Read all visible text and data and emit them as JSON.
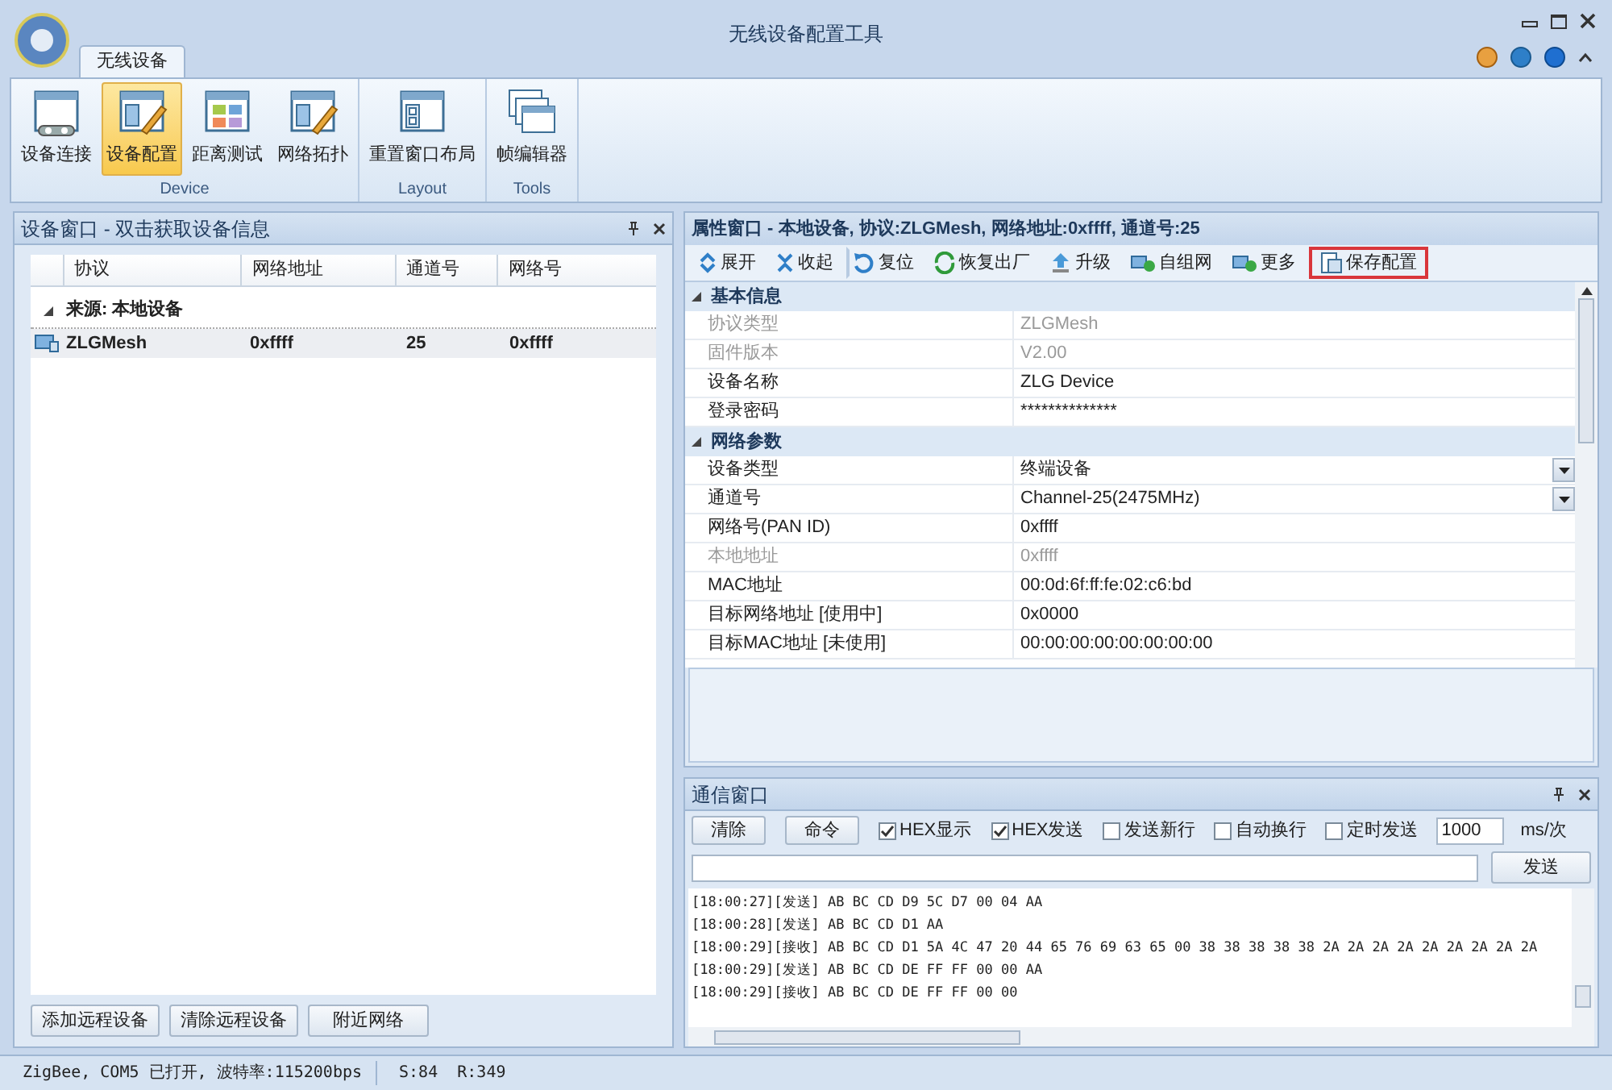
{
  "window": {
    "title": "无线设备配置工具"
  },
  "ribbon": {
    "tab": "无线设备",
    "groups": [
      {
        "label": "Device",
        "items": [
          {
            "label": "设备连接",
            "selected": false
          },
          {
            "label": "设备配置",
            "selected": true
          },
          {
            "label": "距离测试",
            "selected": false
          },
          {
            "label": "网络拓扑",
            "selected": false
          }
        ]
      },
      {
        "label": "Layout",
        "items": [
          {
            "label": "重置窗口布局",
            "selected": false
          }
        ]
      },
      {
        "label": "Tools",
        "items": [
          {
            "label": "帧编辑器",
            "selected": false
          }
        ]
      }
    ]
  },
  "device_panel": {
    "title": "设备窗口 - 双击获取设备信息",
    "columns": [
      "协议",
      "网络地址",
      "通道号",
      "网络号"
    ],
    "group": {
      "label": "来源: 本地设备",
      "expanded": true,
      "rows": [
        {
          "cells": [
            "ZLGMesh",
            "0xffff",
            "25",
            "0xffff"
          ],
          "selected": true
        }
      ]
    },
    "buttons": [
      "添加远程设备",
      "清除远程设备",
      "附近网络"
    ]
  },
  "property_panel": {
    "title": "属性窗口 - 本地设备, 协议:ZLGMesh, 网络地址:0xffff, 通道号:25",
    "toolbar": [
      {
        "label": "展开",
        "highlighted": false
      },
      {
        "label": "收起",
        "highlighted": false
      },
      {
        "label": "复位",
        "highlighted": false
      },
      {
        "label": "恢复出厂",
        "highlighted": false
      },
      {
        "label": "升级",
        "highlighted": false
      },
      {
        "label": "自组网",
        "highlighted": false
      },
      {
        "label": "更多",
        "highlighted": false
      },
      {
        "label": "保存配置",
        "highlighted": true
      }
    ],
    "categories": [
      {
        "label": "基本信息",
        "expanded": true,
        "rows": [
          {
            "name": "协议类型",
            "value": "ZLGMesh",
            "disabled": true,
            "kind": "text"
          },
          {
            "name": "固件版本",
            "value": "V2.00",
            "disabled": true,
            "kind": "text"
          },
          {
            "name": "设备名称",
            "value": "ZLG Device",
            "disabled": false,
            "kind": "text"
          },
          {
            "name": "登录密码",
            "value": "**************",
            "disabled": false,
            "kind": "text"
          }
        ]
      },
      {
        "label": "网络参数",
        "expanded": true,
        "rows": [
          {
            "name": "设备类型",
            "value": "终端设备",
            "disabled": false,
            "kind": "dropdown"
          },
          {
            "name": "通道号",
            "value": "Channel-25(2475MHz)",
            "disabled": false,
            "kind": "dropdown"
          },
          {
            "name": "网络号(PAN ID)",
            "value": "0xffff",
            "disabled": false,
            "kind": "text"
          },
          {
            "name": "本地地址",
            "value": "0xffff",
            "disabled": true,
            "kind": "text"
          },
          {
            "name": "MAC地址",
            "value": "00:0d:6f:ff:fe:02:c6:bd",
            "disabled": false,
            "kind": "text"
          },
          {
            "name": "目标网络地址 [使用中]",
            "value": "0x0000",
            "disabled": false,
            "kind": "text"
          },
          {
            "name": "目标MAC地址 [未使用]",
            "value": "00:00:00:00:00:00:00:00",
            "disabled": false,
            "kind": "text"
          }
        ]
      }
    ]
  },
  "comm_panel": {
    "title": "通信窗口",
    "buttons": [
      "清除",
      "命令"
    ],
    "options": [
      {
        "label": "HEX显示",
        "checked": true
      },
      {
        "label": "HEX发送",
        "checked": true
      },
      {
        "label": "发送新行",
        "checked": false
      },
      {
        "label": "自动换行",
        "checked": false
      },
      {
        "label": "定时发送",
        "checked": false
      }
    ],
    "interval": "1000",
    "interval_unit": "ms/次",
    "send_button": "发送",
    "log": [
      "[18:00:27][发送] AB BC CD D9 5C D7 00 04 AA",
      "[18:00:28][发送] AB BC CD D1 AA",
      "[18:00:29][接收] AB BC CD D1 5A 4C 47 20 44 65 76 69 63 65 00 38 38 38 38 38 2A 2A 2A 2A 2A 2A 2A 2A 2A",
      "[18:00:29][发送] AB BC CD DE FF FF 00 00 AA",
      "[18:00:29][接收] AB BC CD DE FF FF 00 00"
    ]
  },
  "status_bar": [
    "ZigBee, COM5 已打开, 波特率:115200bps",
    "S:84  R:349"
  ]
}
